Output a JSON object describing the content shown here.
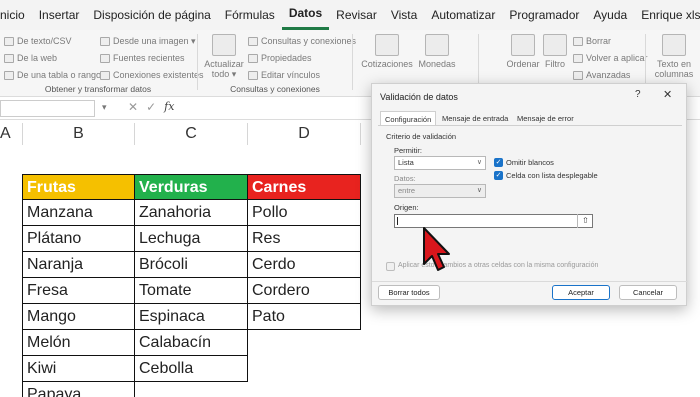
{
  "menu": {
    "items": [
      "nicio",
      "Insertar",
      "Disposición de página",
      "Fórmulas",
      "Datos",
      "Revisar",
      "Vista",
      "Automatizar",
      "Programador",
      "Ayuda",
      "Enrique xls"
    ],
    "active": "Datos"
  },
  "ribbon": {
    "obtener": {
      "items": [
        "De texto/CSV",
        "De la web",
        "De una tabla o rango",
        "Desde una imagen ▾",
        "Fuentes recientes",
        "Conexiones existentes"
      ],
      "label": "Obtener y transformar datos"
    },
    "consultas": {
      "actualizar": [
        "Actualizar",
        "todo ▾"
      ],
      "items": [
        "Consultas y conexiones",
        "Propiedades",
        "Editar vínculos"
      ],
      "label": "Consultas y conexiones"
    },
    "tipos": {
      "cotizaciones": "Cotizaciones",
      "monedas": "Monedas"
    },
    "ordenar": {
      "ordenar": "Ordenar",
      "filtro": "Filtro",
      "items": [
        "Borrar",
        "Volver a aplicar",
        "Avanzadas"
      ]
    },
    "columnas": [
      "Texto en",
      "columnas"
    ]
  },
  "formula_bar": {
    "fx": "fx",
    "x": "✕",
    "check": "✓"
  },
  "sheet": {
    "columns": [
      "A",
      "B",
      "C",
      "D"
    ],
    "headers": [
      "Frutas",
      "Verduras",
      "Carnes"
    ],
    "frutas": [
      "Manzana",
      "Plátano",
      "Naranja",
      "Fresa",
      "Mango",
      "Melón",
      "Kiwi",
      "Papaya"
    ],
    "verduras": [
      "Zanahoria",
      "Lechuga",
      "Brócoli",
      "Tomate",
      "Espinaca",
      "Calabacín",
      "Cebolla"
    ],
    "carnes": [
      "Pollo",
      "Res",
      "Cerdo",
      "Cordero",
      "Pato"
    ],
    "colors": {
      "frutas": "#f5c000",
      "verduras": "#22b14c",
      "carnes": "#e8231f"
    }
  },
  "dialog": {
    "title": "Validación de datos",
    "help": "?",
    "close": "✕",
    "tabs": [
      "Configuración",
      "Mensaje de entrada",
      "Mensaje de error"
    ],
    "criteria": "Criterio de validación",
    "permitir_label": "Permitir:",
    "permitir_value": "Lista",
    "datos_label": "Datos:",
    "datos_value": "entre",
    "omitir": "Omitir blancos",
    "celda": "Celda con lista desplegable",
    "origen_label": "Origen:",
    "origen_value": "",
    "aplicar": "Aplicar estos cambios a otras celdas con la misma configuración",
    "borrar": "Borrar todos",
    "aceptar": "Aceptar",
    "cancelar": "Cancelar"
  }
}
